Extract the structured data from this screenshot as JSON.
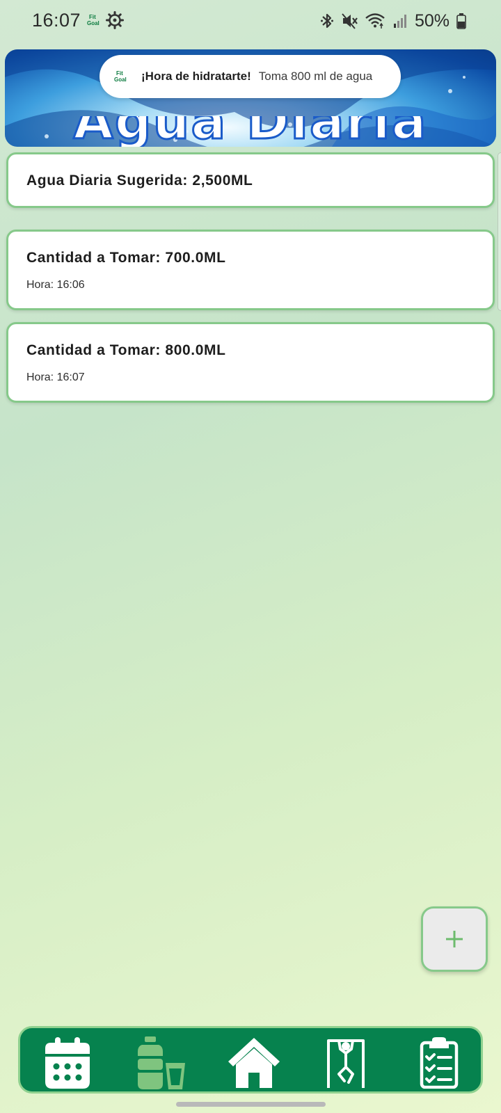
{
  "status_bar": {
    "time": "16:07",
    "battery_percent": "50%",
    "icons": [
      "fitgoal-app-icon",
      "gear-icon",
      "bluetooth-icon",
      "mute-icon",
      "wifi-icon",
      "signal-icon",
      "battery-icon"
    ]
  },
  "banner": {
    "title": "Agua Diaria"
  },
  "notification": {
    "app_icon_text": "Fit Goal",
    "title": "¡Hora de hidratarte!",
    "text": "Toma 800 ml de agua"
  },
  "suggested": {
    "title": "Agua Diaria Sugerida: 2,500ML"
  },
  "entries": [
    {
      "title": "Cantidad a Tomar: 700.0ML",
      "time": "Hora: 16:06"
    },
    {
      "title": "Cantidad a Tomar: 800.0ML",
      "time": "Hora: 16:07"
    }
  ],
  "fab": {
    "icon": "plus-icon"
  },
  "bottom_nav": {
    "items": [
      {
        "icon": "calendar-icon",
        "active": false
      },
      {
        "icon": "water-bottle-icon",
        "active": true
      },
      {
        "icon": "home-icon",
        "active": false
      },
      {
        "icon": "workout-icon",
        "active": false
      },
      {
        "icon": "clipboard-checklist-icon",
        "active": false
      }
    ]
  },
  "colors": {
    "nav_background": "#06824e",
    "card_border": "#86c98a",
    "active_nav_icon": "#7fc47f",
    "icon_white": "#ffffff"
  }
}
